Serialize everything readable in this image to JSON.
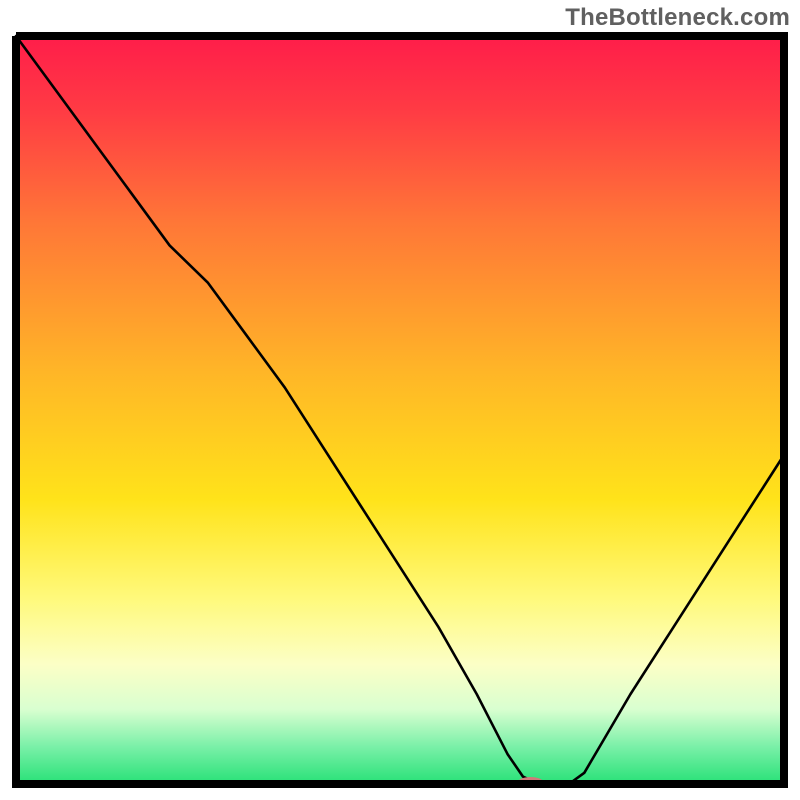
{
  "watermark": "TheBottleneck.com",
  "chart_data": {
    "type": "line",
    "title": "",
    "xlabel": "",
    "ylabel": "",
    "xlim": [
      0,
      100
    ],
    "ylim": [
      0,
      100
    ],
    "grid": false,
    "legend": false,
    "series": [
      {
        "name": "curve",
        "x": [
          0,
          5,
          10,
          15,
          20,
          25,
          30,
          35,
          40,
          45,
          50,
          55,
          60,
          62,
          64,
          66,
          68,
          70,
          72,
          74,
          76,
          80,
          85,
          90,
          95,
          100
        ],
        "values": [
          100,
          93,
          86,
          79,
          72,
          67,
          60,
          53,
          45,
          37,
          29,
          21,
          12,
          8,
          4,
          1,
          0,
          0,
          0,
          1.5,
          5,
          12,
          20,
          28,
          36,
          44
        ]
      }
    ],
    "marker": {
      "name": "selected-point",
      "x": 67,
      "y": 0,
      "color": "#cf7a7a",
      "rx": 14,
      "ry": 7
    },
    "background_gradient": {
      "stops": [
        {
          "offset": 0.0,
          "color": "#ff1d4a"
        },
        {
          "offset": 0.1,
          "color": "#ff3b44"
        },
        {
          "offset": 0.25,
          "color": "#ff7737"
        },
        {
          "offset": 0.45,
          "color": "#ffb627"
        },
        {
          "offset": 0.62,
          "color": "#ffe31a"
        },
        {
          "offset": 0.75,
          "color": "#fff97a"
        },
        {
          "offset": 0.84,
          "color": "#fcffc6"
        },
        {
          "offset": 0.9,
          "color": "#d9ffd0"
        },
        {
          "offset": 0.95,
          "color": "#7af0a8"
        },
        {
          "offset": 1.0,
          "color": "#27e177"
        }
      ]
    },
    "axis_color": "#000000",
    "curve_color": "#000000",
    "curve_width": 2.6
  }
}
